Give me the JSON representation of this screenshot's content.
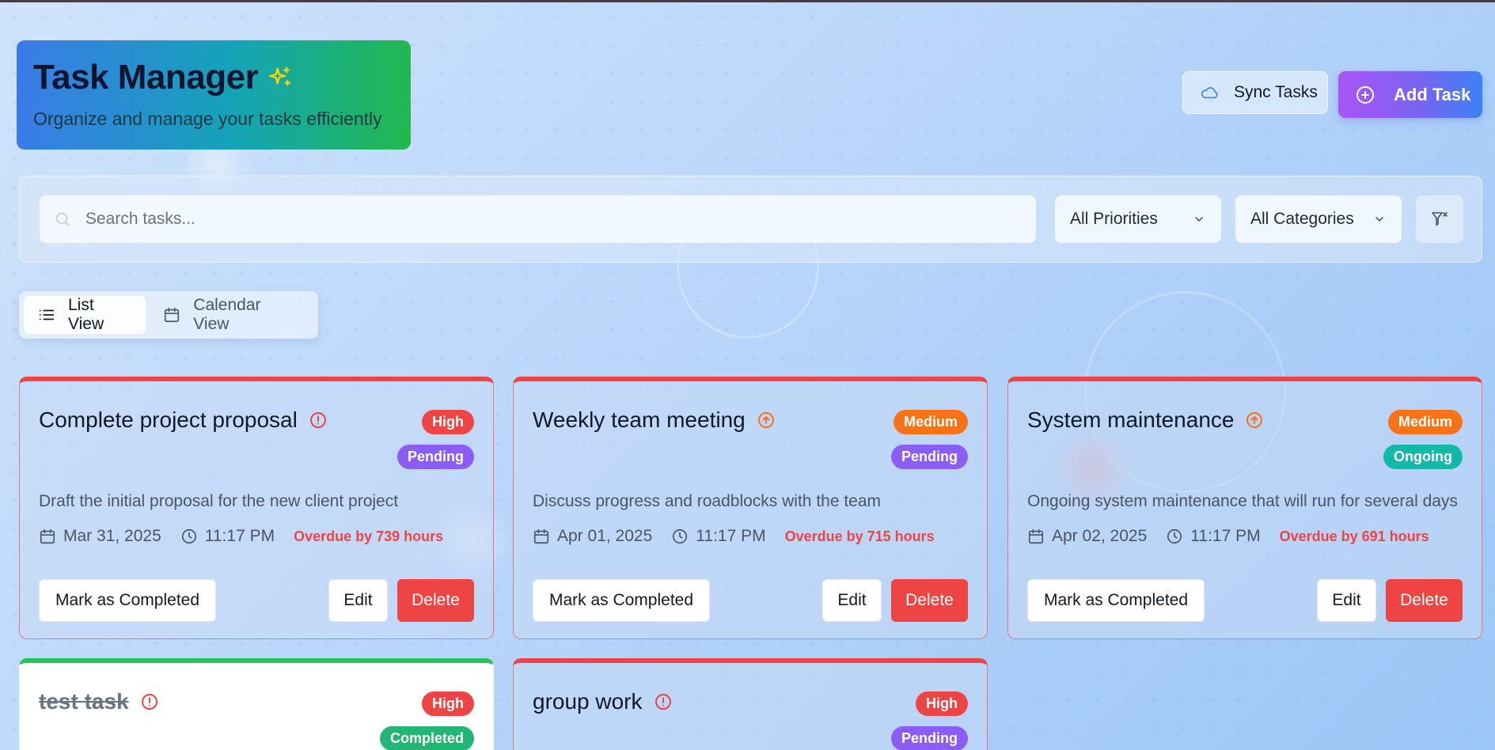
{
  "header": {
    "title": "Task Manager",
    "subtitle": "Organize and manage your tasks efficiently",
    "sync_label": "Sync Tasks",
    "add_label": "Add Task"
  },
  "filters": {
    "search_placeholder": "Search tasks...",
    "priority_selected": "All Priorities",
    "category_selected": "All Categories"
  },
  "views": {
    "list_label": "List View",
    "calendar_label": "Calendar View"
  },
  "tasks": [
    {
      "title": "Complete project proposal",
      "priority": "High",
      "status": "Pending",
      "description": "Draft the initial proposal for the new client project",
      "date": "Mar 31, 2025",
      "time": "11:17 PM",
      "overdue": "Overdue by 739 hours",
      "complete_label": "Mark as Completed",
      "edit_label": "Edit",
      "delete_label": "Delete"
    },
    {
      "title": "Weekly team meeting",
      "priority": "Medium",
      "status": "Pending",
      "description": "Discuss progress and roadblocks with the team",
      "date": "Apr 01, 2025",
      "time": "11:17 PM",
      "overdue": "Overdue by 715 hours",
      "complete_label": "Mark as Completed",
      "edit_label": "Edit",
      "delete_label": "Delete"
    },
    {
      "title": "System maintenance",
      "priority": "Medium",
      "status": "Ongoing",
      "description": "Ongoing system maintenance that will run for several days",
      "date": "Apr 02, 2025",
      "time": "11:17 PM",
      "overdue": "Overdue by 691 hours",
      "complete_label": "Mark as Completed",
      "edit_label": "Edit",
      "delete_label": "Delete"
    },
    {
      "title": "test task",
      "priority": "High",
      "status": "Completed"
    },
    {
      "title": "group work",
      "priority": "High",
      "status": "Pending"
    }
  ],
  "colors": {
    "high": "#ef4444",
    "medium": "#f97316",
    "pending": "#8b5cf6",
    "ongoing": "#14b8a6",
    "completed": "#22c55e",
    "accent_purple": "#a855f7",
    "accent_blue": "#3b82f6"
  },
  "icons": {
    "title_icon": "sparkles-icon",
    "sync_icon": "cloud-icon",
    "add_icon": "plus-circle-icon",
    "search_icon": "search-icon",
    "list_icon": "list-icon",
    "calendar_icon": "calendar-icon",
    "clear_filter_icon": "filter-x-icon",
    "high_priority_icon": "alert-circle-icon",
    "medium_priority_icon": "arrow-up-circle-icon"
  }
}
